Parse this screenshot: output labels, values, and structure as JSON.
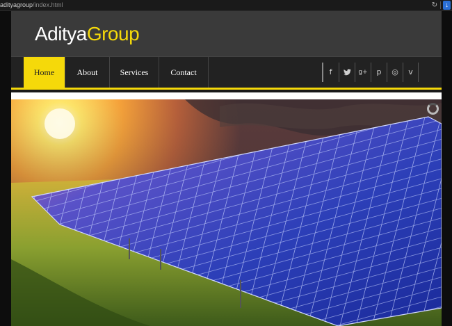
{
  "browser": {
    "url_host": "adityagroup",
    "url_path": "/index.html",
    "reload_icon": "reload-icon",
    "download_icon": "download-icon"
  },
  "header": {
    "logo_part1": "Aditya",
    "logo_part2": "Group"
  },
  "nav": {
    "items": [
      {
        "label": "Home",
        "active": true
      },
      {
        "label": "About",
        "active": false
      },
      {
        "label": "Services",
        "active": false
      },
      {
        "label": "Contact",
        "active": false
      }
    ],
    "social": [
      {
        "icon": "facebook-icon",
        "glyph": "f"
      },
      {
        "icon": "twitter-icon",
        "glyph": "t"
      },
      {
        "icon": "google-plus-icon",
        "glyph": "g+"
      },
      {
        "icon": "pinterest-icon",
        "glyph": "p"
      },
      {
        "icon": "dribbble-icon",
        "glyph": "◎"
      },
      {
        "icon": "vimeo-icon",
        "glyph": "v"
      }
    ]
  },
  "hero": {
    "image": "solar-panels-sunset",
    "loader_icon": "loading-spinner-icon"
  },
  "colors": {
    "accent": "#f5d90a",
    "header_bg": "#3a3a3a",
    "nav_bg": "#222222"
  }
}
